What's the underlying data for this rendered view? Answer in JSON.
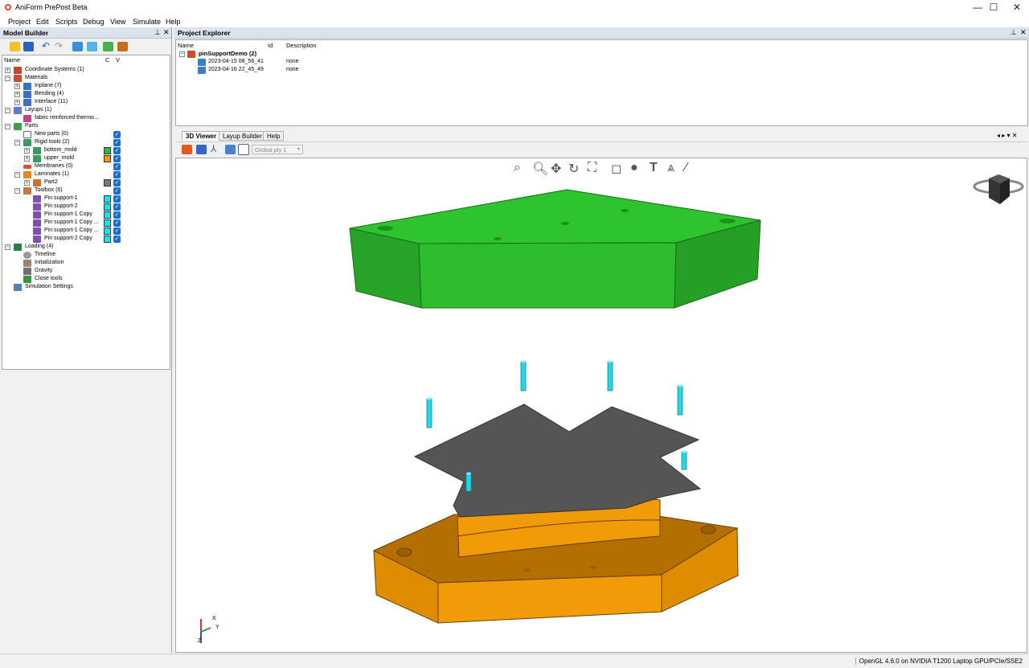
{
  "window": {
    "title": "AniForm PrePost Beta",
    "minimize": "—",
    "maximize": "☐",
    "close": "✕"
  },
  "menu": [
    "Project",
    "Edit",
    "Scripts",
    "Debug",
    "View",
    "Simulate",
    "Help"
  ],
  "model_builder": {
    "title": "Model Builder",
    "pin": "⊥",
    "close": "✕",
    "columns": {
      "name": "Name",
      "c": "C",
      "v": "V"
    },
    "tree": [
      {
        "label": "Coordinate Systems (1)"
      },
      {
        "label": "Materials"
      },
      {
        "label": "Inplane (7)"
      },
      {
        "label": "Bending (4)"
      },
      {
        "label": "Interface (11)"
      },
      {
        "label": "Layups (1)"
      },
      {
        "label": "fabric reinforced thermo..."
      },
      {
        "label": "Parts"
      },
      {
        "label": "New parts (0)"
      },
      {
        "label": "Rigid tools (2)"
      },
      {
        "label": "bottom_mold",
        "color": "#3cb43c"
      },
      {
        "label": "upper_mold",
        "color": "#f09a10"
      },
      {
        "label": "Membranes (0)"
      },
      {
        "label": "Laminates (1)"
      },
      {
        "label": "Part2",
        "color": "#777777"
      },
      {
        "label": "Toolbox (6)"
      },
      {
        "label": "Pin support-1",
        "color": "#1ee0f0"
      },
      {
        "label": "Pin support-2",
        "color": "#1ee0f0"
      },
      {
        "label": "Pin support-1 Copy",
        "color": "#1ee0f0"
      },
      {
        "label": "Pin support-1 Copy ...",
        "color": "#1ee0f0"
      },
      {
        "label": "Pin support-1 Copy ...",
        "color": "#1ee0f0"
      },
      {
        "label": "Pin support-2 Copy",
        "color": "#1ee0f0"
      },
      {
        "label": "Loading (4)"
      },
      {
        "label": "Timeline"
      },
      {
        "label": "Initialization"
      },
      {
        "label": "Gravity"
      },
      {
        "label": "Close tools"
      },
      {
        "label": "Simulation Settings"
      }
    ]
  },
  "project_explorer": {
    "title": "Project Explorer",
    "pin": "⊥",
    "close": "✕",
    "columns": {
      "name": "Name",
      "id": "Id",
      "description": "Description"
    },
    "project": "pinSupportDemo (2)",
    "runs": [
      {
        "name": "2023-04-15 08_56_41",
        "description": "none"
      },
      {
        "name": "2023-04-16 22_45_49",
        "description": "none"
      }
    ]
  },
  "viewer": {
    "tabs": [
      "3D Viewer",
      "Layup Builder",
      "Help"
    ],
    "active_tab": "3D Viewer",
    "ply_select": "Global ply 1",
    "tab_controls": "◂ ▸ ▾ ✕",
    "axes": {
      "x": "X",
      "y": "Y",
      "z": "Z"
    },
    "colors": {
      "upper_mold": "#2ebd2e",
      "bottom_mold": "#f19b09",
      "laminate": "#555555",
      "pins": "#24d6e8"
    }
  },
  "status": {
    "text": "OpenGL 4.6.0 on NVIDIA T1200 Laptop GPU/PCIe/SSE2"
  }
}
